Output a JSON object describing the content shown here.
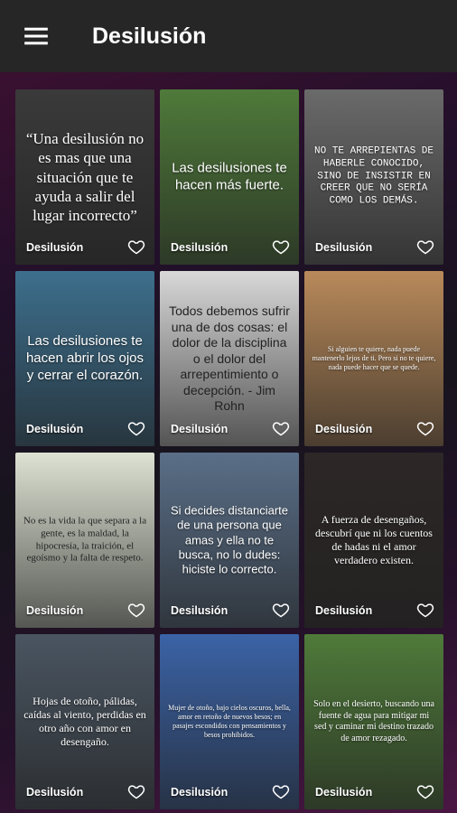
{
  "appbar": {
    "title": "Desilusión",
    "menu_icon": "hamburger-menu-icon"
  },
  "cards": [
    {
      "quote": "“Una desilusión no es mas que una situación que te ayuda a salir del lugar incorrecto”",
      "label": "Desilusión",
      "bg": "#3a3a3a",
      "color": "#ffffff",
      "font": "serif",
      "size": 17
    },
    {
      "quote": "Las desilusiones te hacen más fuerte.",
      "label": "Desilusión",
      "bg": "#4f7a3a",
      "color": "#ffffff",
      "font": "sans",
      "size": 15
    },
    {
      "quote": "NO TE ARREPIENTAS DE HABERLE CONOCIDO, SINO DE INSISTIR EN CREER QUE NO SERÍA COMO LOS DEMÁS.",
      "label": "Desilusión",
      "bg": "#6a6a6a",
      "color": "#ffffff",
      "font": "mono",
      "size": 11
    },
    {
      "quote": "Las desilusiones te hacen abrir los ojos y cerrar el corazón.",
      "label": "Desilusión",
      "bg": "#3d6f8d",
      "color": "#ffffff",
      "font": "sans",
      "size": 15
    },
    {
      "quote": "Todos debemos sufrir una de dos cosas: el dolor de la disciplina o el dolor del arrepentimiento o decepción. - Jim Rohn",
      "label": "Desilusión",
      "bg": "#d8d8d8",
      "color": "#222222",
      "font": "sans",
      "size": 14
    },
    {
      "quote": "Si alguien te quiere, nada puede mantenerlo lejos de ti. Pero si no te quiere, nada puede hacer que se quede.",
      "label": "Desilusión",
      "bg": "#b98a5a",
      "color": "#ffffff",
      "font": "serif",
      "size": 8
    },
    {
      "quote": "No es la vida la que separa a la gente, es la maldad, la hipocresía, la traición, el egoísmo y la falta de respeto.",
      "label": "Desilusión",
      "bg": "#dde2d3",
      "color": "#222222",
      "font": "serif",
      "size": 11
    },
    {
      "quote": "Si decides distanciarte de una persona que amas y ella no te busca, no lo dudes: hiciste lo correcto.",
      "label": "Desilusión",
      "bg": "#5a6f88",
      "color": "#ffffff",
      "font": "sans",
      "size": 13
    },
    {
      "quote": "A fuerza de desengaños, descubrí que ni los cuentos de hadas ni el amor verdadero existen.",
      "label": "Desilusión",
      "bg": "#2d2727",
      "color": "#ffffff",
      "font": "serif",
      "size": 12
    },
    {
      "quote": "Hojas de otoño, pálidas, caídas al viento, perdidas en otro año con amor en desengaño.",
      "label": "Desilusión",
      "bg": "#4a5561",
      "color": "#ffffff",
      "font": "serif",
      "size": 12
    },
    {
      "quote": "Mujer de otoño, bajo cielos oscuros, bella, amor en retoño de nuevos besos; en pasajes escondidos con pensamientos y besos prohibidos.",
      "label": "Desilusión",
      "bg": "#3b63a6",
      "color": "#ffffff",
      "font": "serif",
      "size": 8
    },
    {
      "quote": "Solo en el desierto, buscando una fuente de agua para mitigar mi sed y caminar mi destino trazado de amor rezagado.",
      "label": "Desilusión",
      "bg": "#4f7a3a",
      "color": "#ffffff",
      "font": "serif",
      "size": 10
    }
  ],
  "heart_icon": "heart-outline-icon"
}
